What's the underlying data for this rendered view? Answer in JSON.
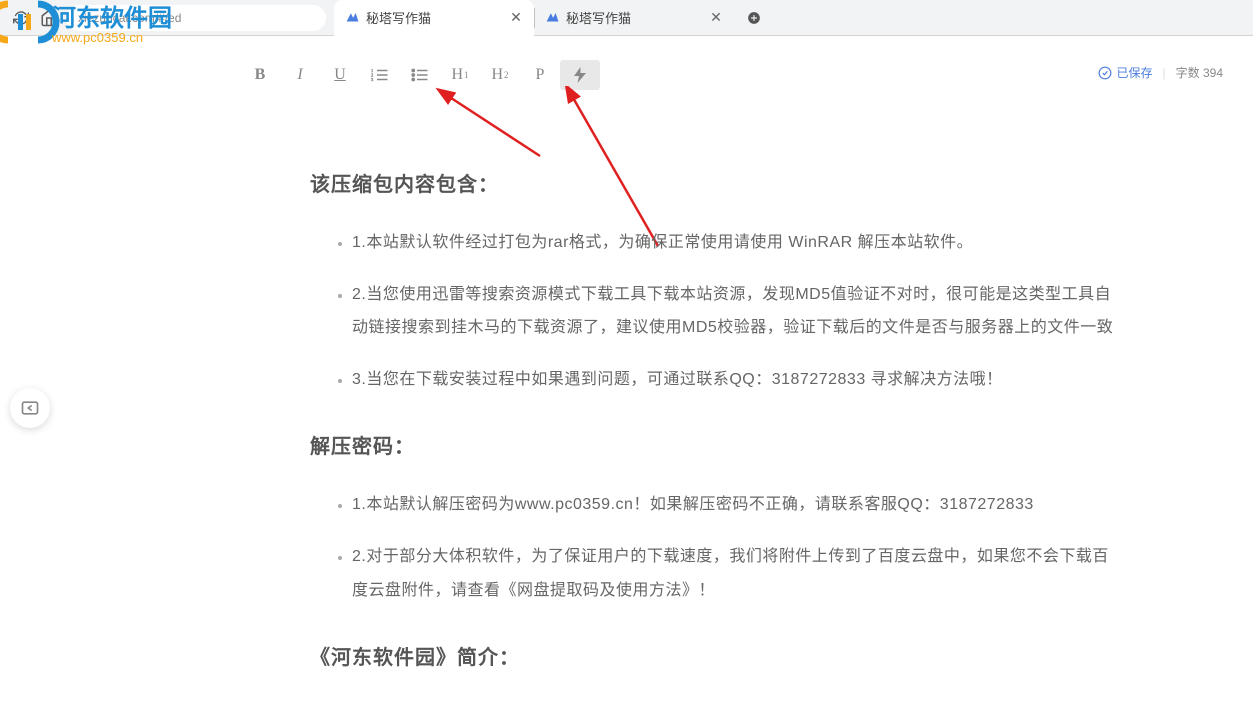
{
  "browser": {
    "url": "xiezuocat.com/#/ed",
    "tabs": [
      {
        "title": "秘塔写作猫",
        "active": true
      },
      {
        "title": "秘塔写作猫",
        "active": false
      }
    ]
  },
  "watermark": {
    "title": "河东软件园",
    "url": "www.pc0359.cn"
  },
  "toolbar": {
    "bold": "B",
    "italic": "I",
    "underline": "U",
    "h1": "H",
    "h2": "H",
    "p": "P"
  },
  "status": {
    "saved_label": "已保存",
    "wordcount_label": "字数",
    "wordcount": "394"
  },
  "content": {
    "heading1": "该压缩包内容包含：",
    "list1": [
      "1.本站默认软件经过打包为rar格式，为确保正常使用请使用 WinRAR 解压本站软件。",
      "2.当您使用迅雷等搜索资源模式下载工具下载本站资源，发现MD5值验证不对时，很可能是这类型工具自动链接搜索到挂木马的下载资源了，建议使用MD5校验器，验证下载后的文件是否与服务器上的文件一致",
      "3.当您在下载安装过程中如果遇到问题，可通过联系QQ：3187272833 寻求解决方法哦！"
    ],
    "heading2": "解压密码：",
    "list2": [
      "1.本站默认解压密码为www.pc0359.cn！如果解压密码不正确，请联系客服QQ：3187272833",
      "2.对于部分大体积软件，为了保证用户的下载速度，我们将附件上传到了百度云盘中，如果您不会下载百度云盘附件，请查看《网盘提取码及使用方法》！"
    ],
    "heading3": "《河东软件园》简介："
  }
}
